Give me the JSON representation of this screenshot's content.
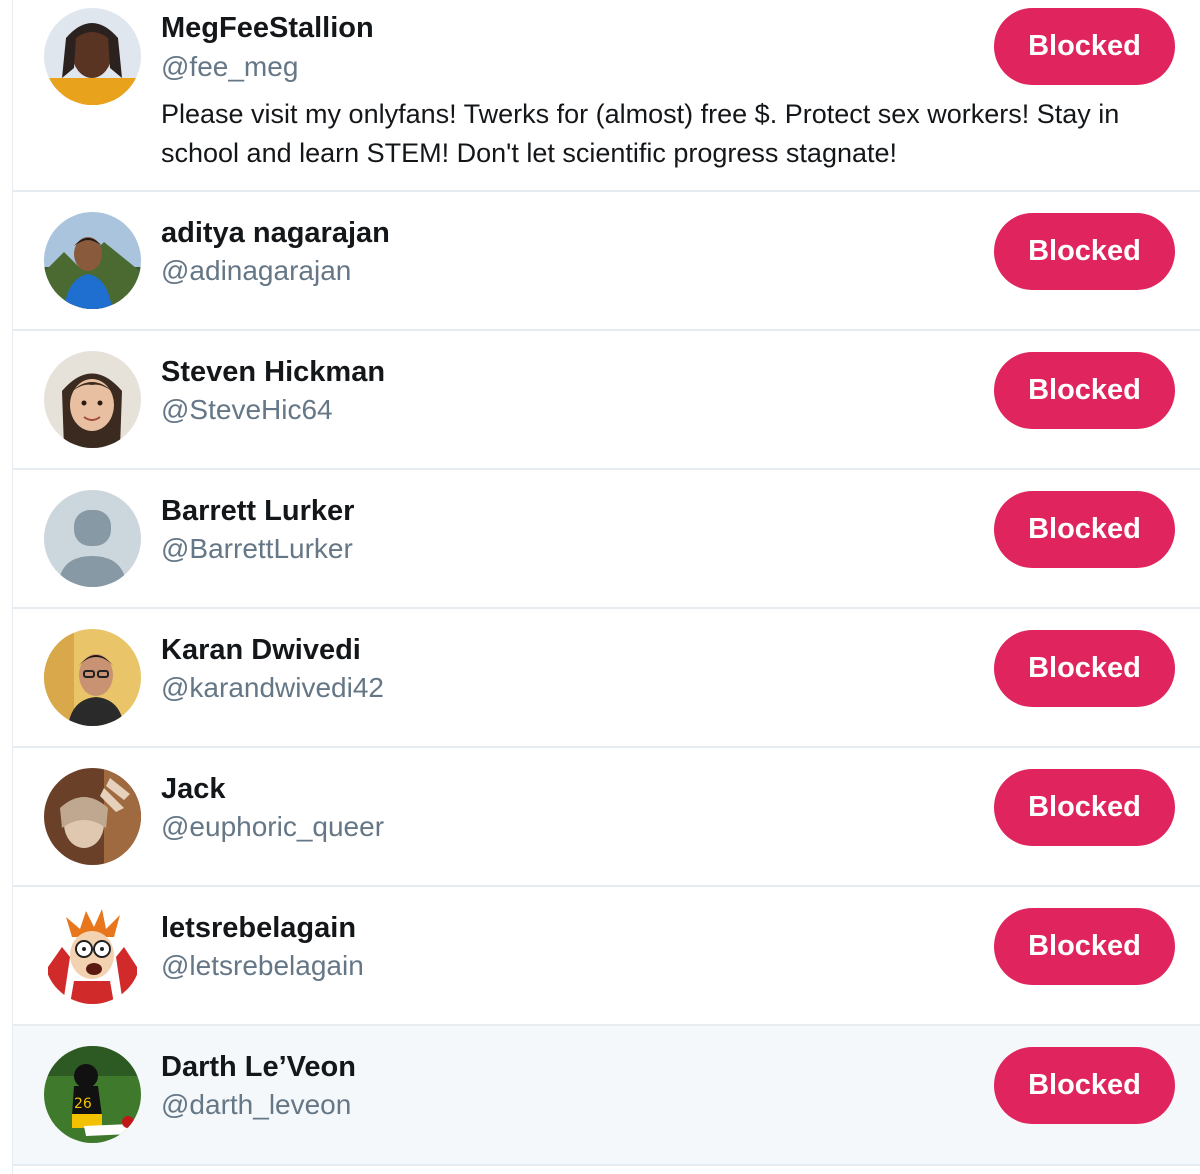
{
  "accounts": [
    {
      "name": "MegFeeStallion",
      "handle": "@fee_meg",
      "bio": "Please visit my onlyfans! Twerks for (almost) free $. Protect sex workers! Stay in school and learn STEM! Don't let scientific progress stagnate!",
      "button": "Blocked"
    },
    {
      "name": "aditya nagarajan",
      "handle": "@adinagarajan",
      "button": "Blocked"
    },
    {
      "name": "Steven Hickman",
      "handle": "@SteveHic64",
      "button": "Blocked"
    },
    {
      "name": "Barrett Lurker",
      "handle": "@BarrettLurker",
      "button": "Blocked"
    },
    {
      "name": "Karan Dwivedi",
      "handle": "@karandwivedi42",
      "button": "Blocked"
    },
    {
      "name": "Jack",
      "handle": "@euphoric_queer",
      "button": "Blocked"
    },
    {
      "name": "letsrebelagain",
      "handle": "@letsrebelagain",
      "button": "Blocked"
    },
    {
      "name": "Darth Le’Veon",
      "handle": "@darth_leveon",
      "button": "Blocked"
    }
  ],
  "colors": {
    "blocked_button": "#e0245e",
    "handle_text": "#657786",
    "divider": "#e6ecf0",
    "hover_row": "#f5f8fa"
  }
}
